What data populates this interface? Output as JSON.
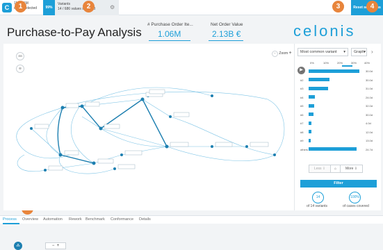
{
  "colors": {
    "accent": "#1d9fd8",
    "marker": "#e8853c"
  },
  "topbar": {
    "logo_letter": "C",
    "cases_line1": "1M of 1M",
    "cases_line2": "cases selected",
    "percent": "99%",
    "variants_line1": "Variants",
    "variants_line2": "14 / 686 values selected",
    "settings_icon": "gear-icon",
    "menu_icon": "menu-icon",
    "reset_label": "Reset selections"
  },
  "markers": [
    "1",
    "2",
    "3",
    "4",
    "5"
  ],
  "header": {
    "title": "Purchase-to-Pay Analysis",
    "kpi1_label": "# Purchase Order Ite...",
    "kpi1_value": "1.06M",
    "kpi2_label": "Net Order Value",
    "kpi2_value": "2.13B €",
    "brand": "celonis"
  },
  "graph": {
    "zoom_label": "Zoom",
    "zoom_minus": "−",
    "zoom_plus": "+",
    "left_btn1": "aa",
    "left_btn2": "⊕"
  },
  "variant_panel": {
    "select_value": "Most common variant",
    "graph_select": "Graph",
    "axis_ticks": [
      "0%",
      "10%",
      "20%",
      "30%",
      "40%"
    ],
    "rows": [
      {
        "label": "#1",
        "pct": "30.0d",
        "value": 0.93
      },
      {
        "label": "#2",
        "pct": "30.0d",
        "value": 0.38
      },
      {
        "label": "#3",
        "pct": "31.0d",
        "value": 0.36
      },
      {
        "label": "#4",
        "pct": "24.0d",
        "value": 0.12
      },
      {
        "label": "#5",
        "pct": "32.0d",
        "value": 0.1
      },
      {
        "label": "#6",
        "pct": "30.0d",
        "value": 0.09
      },
      {
        "label": "#7",
        "pct": "4.0d",
        "value": 0.05
      },
      {
        "label": "#8",
        "pct": "12.0d",
        "value": 0.05
      },
      {
        "label": "#9",
        "pct": "13.0d",
        "value": 0.04
      },
      {
        "label": "others",
        "pct": "24.7d",
        "value": 0.88
      }
    ],
    "less_label": "Less",
    "home_icon": "home-icon",
    "more_label": "More",
    "filter_label": "Filter",
    "stat1_value": "14",
    "stat1_caption": "of 14 variants",
    "stat2_value": "100%",
    "stat2_caption": "of cases covered"
  },
  "tabs": [
    "Process",
    "Overview",
    "Automation",
    "Rework",
    "Benchmark",
    "Conformance",
    "Details"
  ]
}
